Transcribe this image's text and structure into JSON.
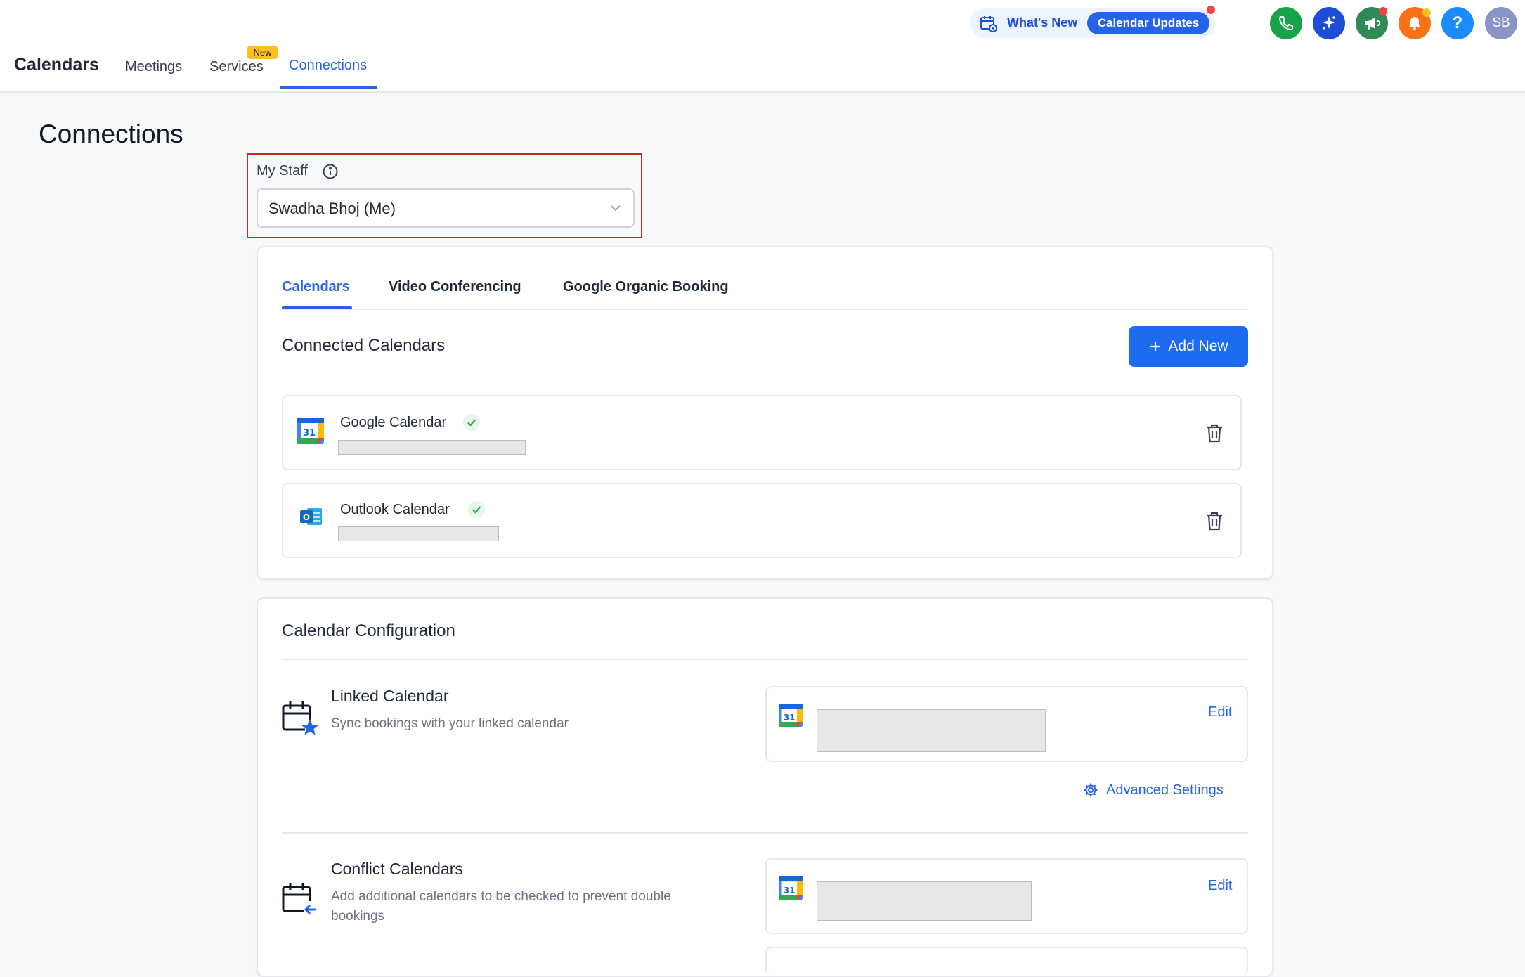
{
  "app": {
    "title": "Calendars",
    "nav_tabs": [
      "Meetings",
      "Services",
      "Connections"
    ],
    "new_badge": "New",
    "active_tab": "Connections"
  },
  "header": {
    "whats_new": "What's New",
    "calendar_updates": "Calendar Updates",
    "avatar_initials": "SB",
    "colors": {
      "phone": "#16a34a",
      "ai": "#1d4ed8",
      "announce": "#2e8b57",
      "bell": "#f97316",
      "help": "#1a8cff"
    }
  },
  "page": {
    "title": "Connections",
    "staff_label": "My Staff",
    "staff_value": "Swadha Bhoj (Me)"
  },
  "calendars_card": {
    "tabs": [
      "Calendars",
      "Video Conferencing",
      "Google Organic Booking"
    ],
    "section_title": "Connected Calendars",
    "add_button": "Add New",
    "connected": [
      {
        "name": "Google Calendar",
        "icon": "google-calendar-icon"
      },
      {
        "name": "Outlook Calendar",
        "icon": "outlook-calendar-icon"
      }
    ]
  },
  "config_card": {
    "title": "Calendar Configuration",
    "linked": {
      "title": "Linked Calendar",
      "desc": "Sync bookings with your linked calendar",
      "edit": "Edit",
      "advanced": "Advanced Settings"
    },
    "conflict": {
      "title": "Conflict Calendars",
      "desc": "Add additional calendars to be checked to prevent double bookings",
      "edit": "Edit"
    }
  },
  "theme": {
    "accent": "#2563eb",
    "highlight_border": "#c62828"
  }
}
